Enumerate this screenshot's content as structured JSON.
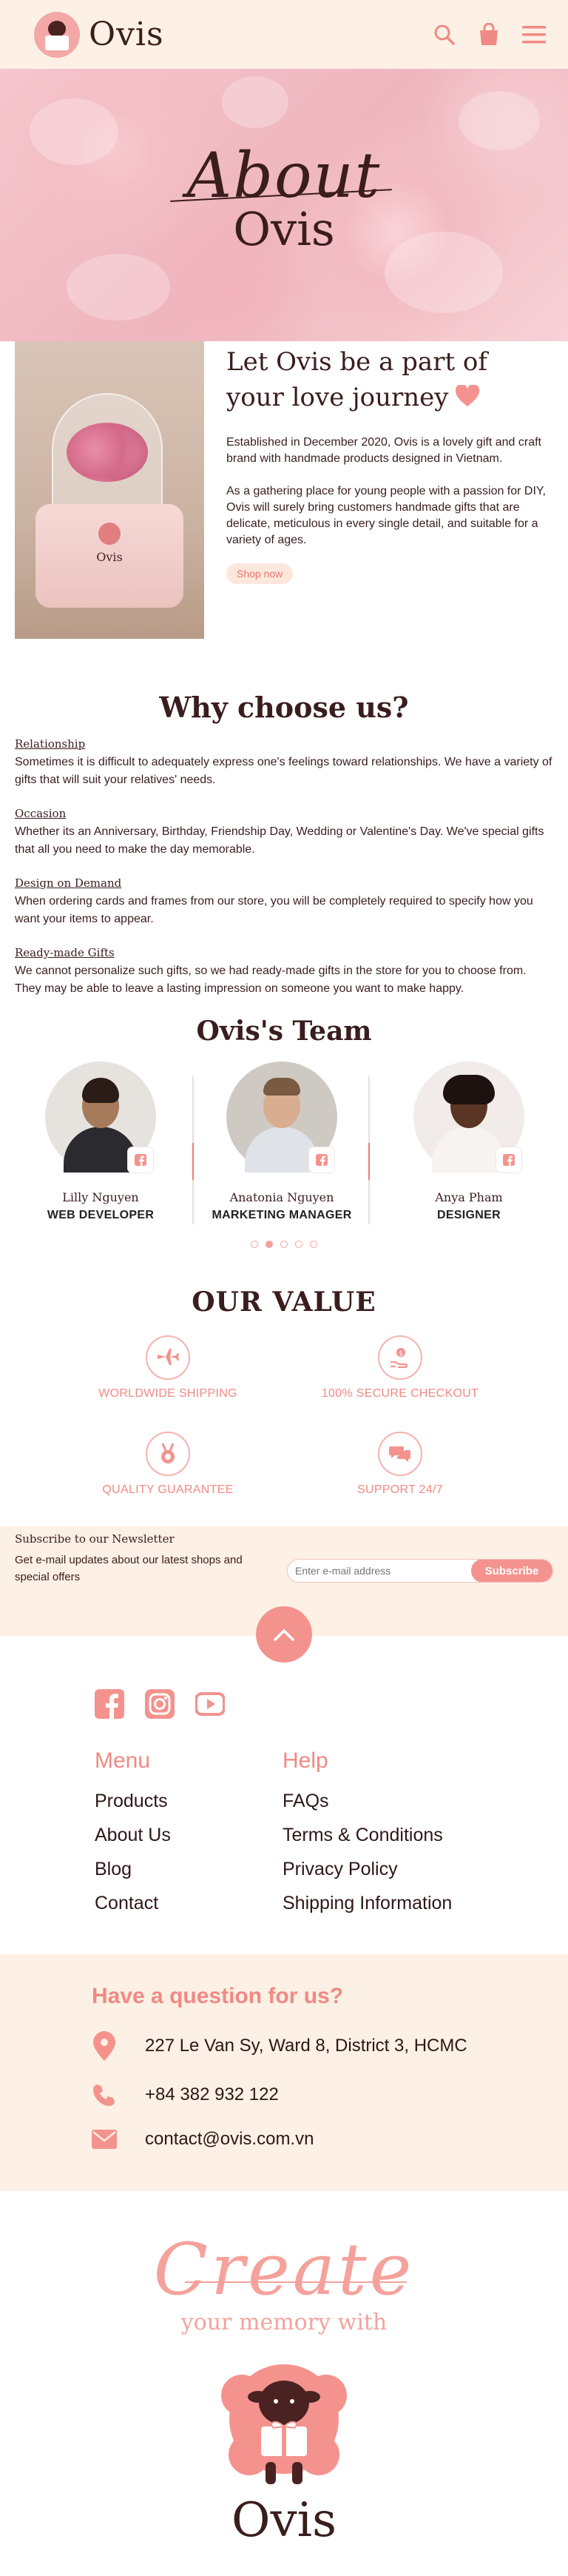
{
  "header": {
    "brand": "Ovis",
    "icons": [
      "search-icon",
      "shopping-bag-icon",
      "menu-icon"
    ],
    "accent": "#f08a84"
  },
  "hero": {
    "about": "About",
    "brand": "Ovis"
  },
  "intro": {
    "title_line1": "Let Ovis be a part of",
    "title_line2": "your love journey",
    "p1": "Established in December 2020, Ovis is a lovely gift and craft brand with handmade products designed in Vietnam.",
    "p2": "As a gathering place for young people with a passion for DIY, Ovis will surely bring customers handmade gifts that are delicate, meticulous in every single detail, and suitable for a variety of ages.",
    "shop_button": "Shop now",
    "image_label": "Ovis"
  },
  "why": {
    "title": "Why choose us?",
    "items": [
      {
        "heading": "Relationship",
        "text": "Sometimes it is difficult to adequately express one's feelings toward relationships. We have a variety of gifts that will suit your relatives' needs."
      },
      {
        "heading": "Occasion",
        "text": "Whether its an Anniversary, Birthday, Friendship Day, Wedding or Valentine's Day. We've special gifts that all you need to make the day memorable."
      },
      {
        "heading": "Design on Demand",
        "text": "When ordering cards and frames from our store, you will be completely required to specify how you want your items to appear."
      },
      {
        "heading": "Ready-made Gifts",
        "text": "We cannot personalize such gifts, so we had ready-made gifts in the store for you to choose from. They may be able to leave a lasting impression on someone you want to make happy."
      }
    ]
  },
  "team": {
    "title": "Ovis's Team",
    "members": [
      {
        "name": "Lilly Nguyen",
        "role": "WEB DEVELOPER"
      },
      {
        "name": "Anatonia Nguyen",
        "role": "MARKETING MANAGER"
      },
      {
        "name": "Anya Pham",
        "role": "DESIGNER"
      }
    ],
    "carousel_dots": 5,
    "active_dot": 2
  },
  "values": {
    "title": "OUR VALUE",
    "items": [
      {
        "label": "WORLDWIDE SHIPPING",
        "icon": "airplane-icon"
      },
      {
        "label": "100% SECURE CHECKOUT",
        "icon": "secure-payment-icon"
      },
      {
        "label": "QUALITY GUARANTEE",
        "icon": "medal-icon"
      },
      {
        "label": "SUPPORT 24/7",
        "icon": "chat-bubbles-icon"
      }
    ]
  },
  "newsletter": {
    "title": "Subscribe to our Newsletter",
    "subtitle": "Get e-mail updates about our latest shops and special offers",
    "placeholder": "Enter e-mail address",
    "button": "Subscribe"
  },
  "footer": {
    "social": [
      "facebook-icon",
      "instagram-icon",
      "youtube-icon"
    ],
    "menu_title": "Menu",
    "menu_items": [
      "Products",
      "About Us",
      "Blog",
      "Contact"
    ],
    "help_title": "Help",
    "help_items": [
      "FAQs",
      "Terms & Conditions",
      "Privacy Policy",
      "Shipping Information"
    ]
  },
  "contact": {
    "title": "Have a question for us?",
    "address": "227 Le Van Sy, Ward 8,  District 3, HCMC",
    "phone": "+84 382 932 122",
    "email": "contact@ovis.com.vn"
  },
  "closing": {
    "create": "Create",
    "memory": "your memory with",
    "brand": "Ovis"
  },
  "colors": {
    "cream": "#fdf0e4",
    "pink": "#f4938e",
    "dark": "#3a1d1d"
  }
}
